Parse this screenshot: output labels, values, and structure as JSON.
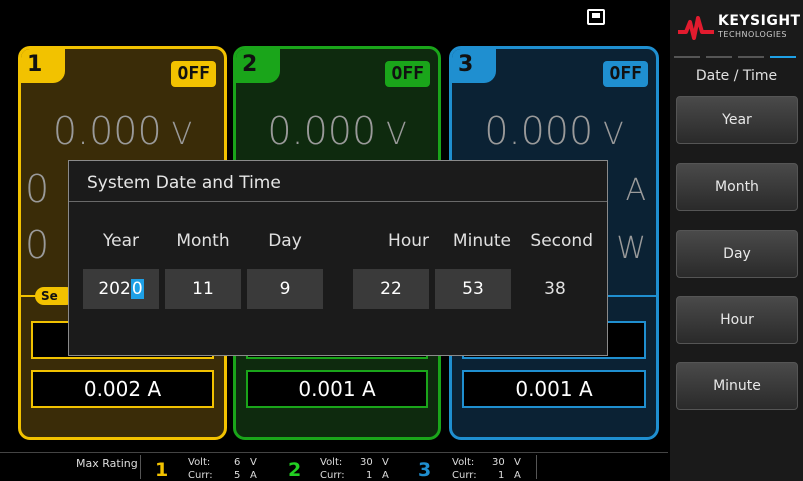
{
  "channels": [
    {
      "num": "1",
      "status": "OFF",
      "voltage": "0.000",
      "voltage_unit": "V",
      "partial_current": "0",
      "partial_power": "0",
      "set_tab": "Se",
      "current_setting": "0.002 A",
      "color": "#f2c200"
    },
    {
      "num": "2",
      "status": "OFF",
      "voltage": "0.000",
      "voltage_unit": "V",
      "current_setting": "0.001 A",
      "color": "#1aa51a"
    },
    {
      "num": "3",
      "status": "OFF",
      "voltage": "0.000",
      "voltage_unit": "V",
      "current_unit": "A",
      "power_unit": "W",
      "current_setting": "0.001 A",
      "color": "#1f8fd0"
    }
  ],
  "dialog": {
    "title": "System Date and Time",
    "labels": [
      "Year",
      "Month",
      "Day",
      "Hour",
      "Minute",
      "Second"
    ],
    "year_prefix": "202",
    "year_cursor": "0",
    "month": "11",
    "day": "9",
    "hour": "22",
    "minute": "53",
    "second": "38"
  },
  "menu": {
    "brand": "KEYSIGHT",
    "brand_sub": "TECHNOLOGIES",
    "title": "Date / Time",
    "softkeys": [
      "Year",
      "Month",
      "Day",
      "Hour",
      "Minute"
    ]
  },
  "bottom": {
    "label": "Max Rating",
    "ch1": {
      "num": "1",
      "volt_label": "Volt:",
      "volt": "6",
      "volt_unit": "V",
      "curr_label": "Curr:",
      "curr": "5",
      "curr_unit": "A"
    },
    "ch2": {
      "num": "2",
      "volt_label": "Volt:",
      "volt": "30",
      "volt_unit": "V",
      "curr_label": "Curr:",
      "curr": "1",
      "curr_unit": "A"
    },
    "ch3": {
      "num": "3",
      "volt_label": "Volt:",
      "volt": "30",
      "volt_unit": "V",
      "curr_label": "Curr:",
      "curr": "1",
      "curr_unit": "A"
    }
  },
  "icons": {
    "lan": "lan-icon",
    "logo": "keysight-logo-icon"
  }
}
